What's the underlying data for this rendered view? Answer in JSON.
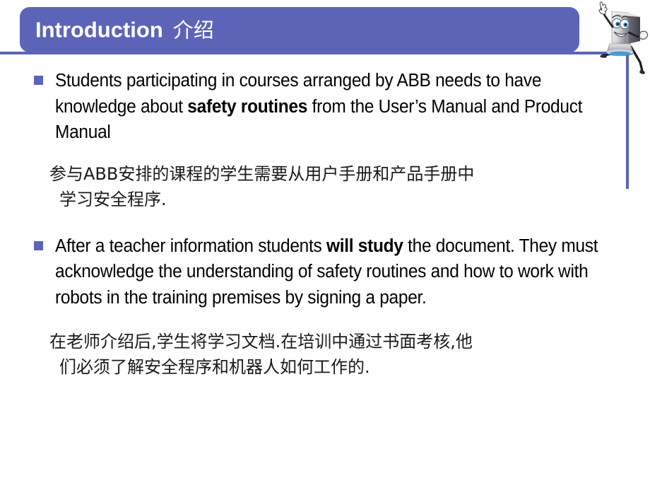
{
  "slide": {
    "title_en": "Introduction",
    "title_cn": "介绍",
    "accent_color": "#5c64b8",
    "background_color": "#ffffff",
    "text_color": "#000000",
    "mascot_name": "computer-robot-mascot"
  },
  "body": {
    "bullets": [
      {
        "id": "bullet-1",
        "segments_plain_1": "Students participating in courses arranged by ABB needs to have knowledge about ",
        "segment_bold": "safety routines",
        "segments_plain_2": " from the User’s Manual and Product Manual"
      },
      {
        "id": "bullet-2",
        "segments_plain_1": "After a teacher information students ",
        "segment_bold": "will study",
        "segments_plain_2": " the document. They must acknowledge the understanding of safety routines and how to work with robots in the training premises by signing a paper."
      }
    ],
    "chinese_paragraphs": [
      {
        "id": "para-cn-1",
        "line1": "参与ABB安排的课程的学生需要从用户手册和产品手册中",
        "line2": "学习安全程序."
      },
      {
        "id": "para-cn-2",
        "line1": "在老师介绍后,学生将学习文档.在培训中通过书面考核,他",
        "line2": "们必须了解安全程序和机器人如何工作的."
      }
    ]
  }
}
